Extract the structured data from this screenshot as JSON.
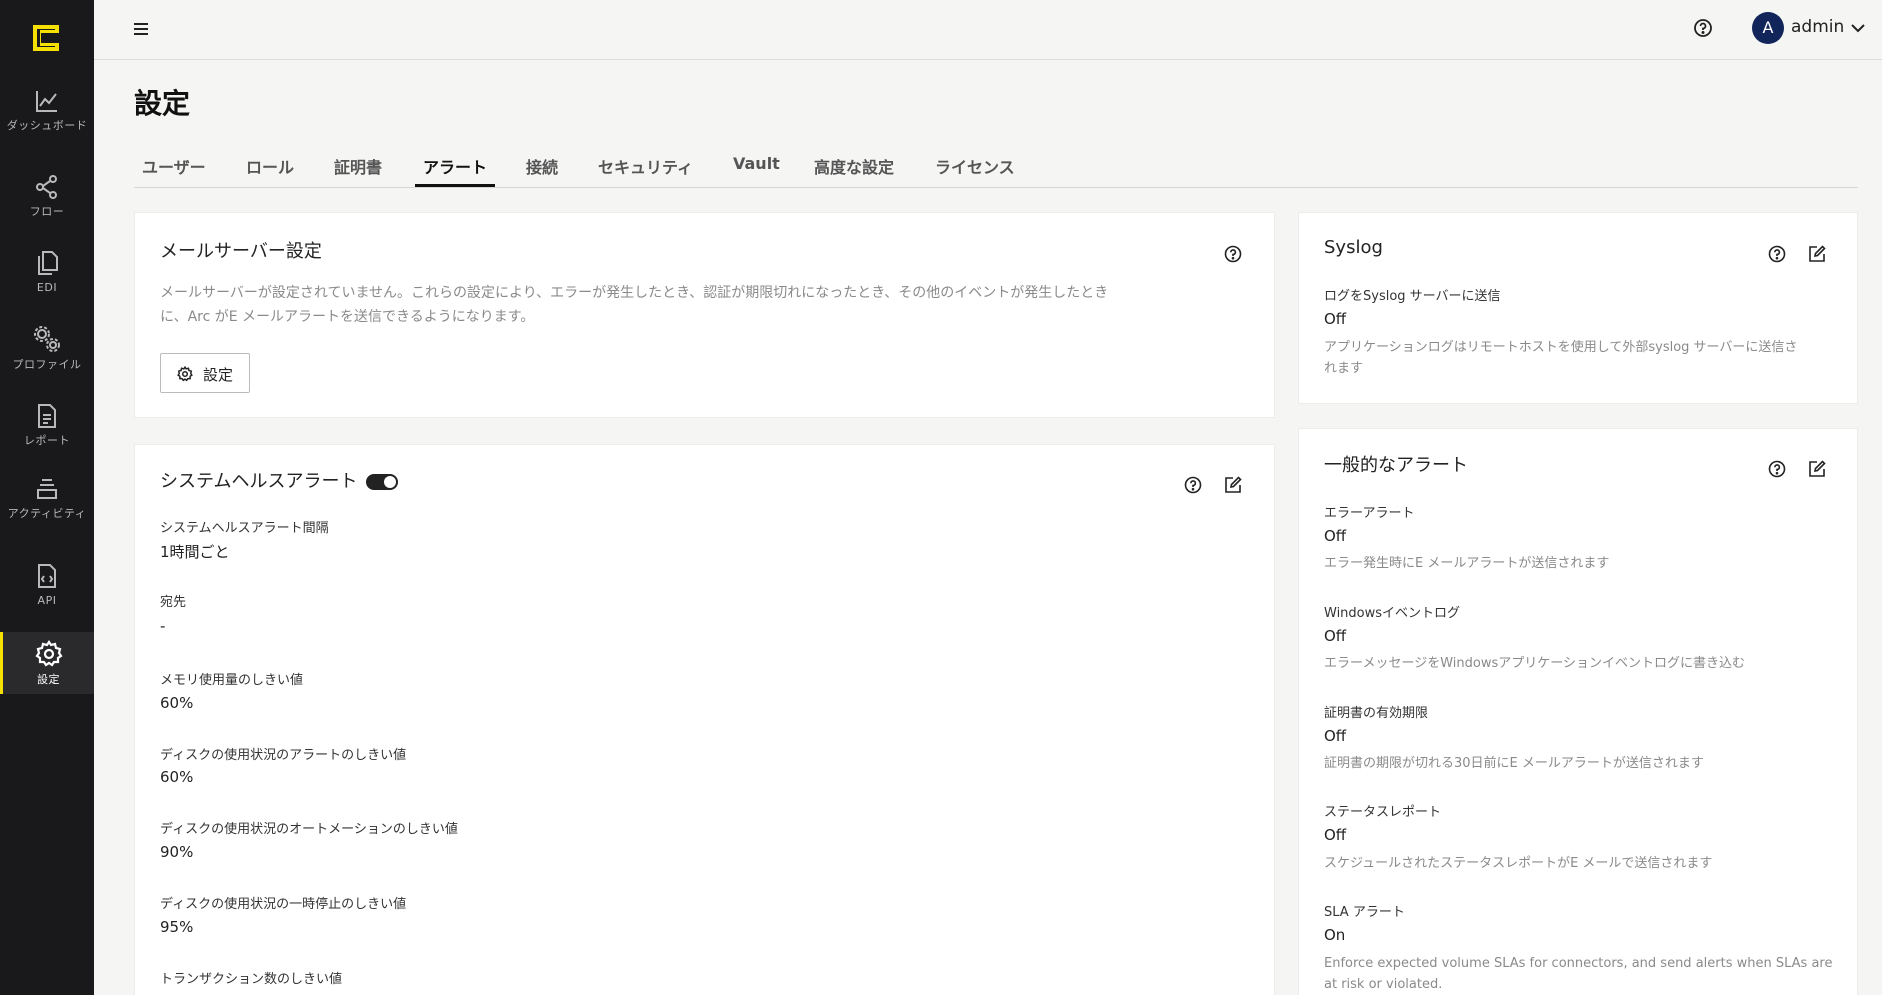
{
  "nav": {
    "items": [
      {
        "label": "ダッシュボード",
        "icon": "chart-line-icon"
      },
      {
        "label": "フロー",
        "icon": "share-nodes-icon"
      },
      {
        "label": "EDI",
        "icon": "documents-icon"
      },
      {
        "label": "プロファイル",
        "icon": "gears-icon"
      },
      {
        "label": "レポート",
        "icon": "report-icon"
      },
      {
        "label": "アクティビティ",
        "icon": "layers-icon"
      },
      {
        "label": "API",
        "icon": "api-file-icon"
      },
      {
        "label": "設定",
        "icon": "gear-icon"
      }
    ],
    "active_index": 7,
    "accent_color": "#f5e000"
  },
  "header": {
    "user_initial": "A",
    "username": "admin",
    "avatar_color": "#12255a"
  },
  "page": {
    "title": "設定",
    "tabs": [
      "ユーザー",
      "ロール",
      "証明書",
      "アラート",
      "接続",
      "セキュリティ",
      "Vault",
      "高度な設定",
      "ライセンス"
    ],
    "active_tab": "アラート"
  },
  "mail_server": {
    "title": "メールサーバー設定",
    "description_line1": "メールサーバーが設定されていません。これらの設定により、エラーが発生したとき、認証が期限切れになったとき、その他のイベントが発生したとき",
    "description_line2": "に、Arc がE メールアラートを送信できるようになります。",
    "button_label": "設定"
  },
  "system_health": {
    "title": "システムヘルスアラート",
    "enabled": true,
    "fields": [
      {
        "label": "システムヘルスアラート間隔",
        "value": "1時間ごと"
      },
      {
        "label": "宛先",
        "value": "-"
      },
      {
        "label": "メモリ使用量のしきい値",
        "value": "60%"
      },
      {
        "label": "ディスクの使用状況のアラートのしきい値",
        "value": "60%"
      },
      {
        "label": "ディスクの使用状況のオートメーションのしきい値",
        "value": "90%"
      },
      {
        "label": "ディスクの使用状況の一時停止のしきい値",
        "value": "95%"
      },
      {
        "label": "トランザクション数のしきい値",
        "value": ""
      }
    ]
  },
  "syslog": {
    "title": "Syslog",
    "label": "ログをSyslog サーバーに送信",
    "value": "Off",
    "hint_line1": "アプリケーションログはリモートホストを使用して外部syslog サーバーに送信さ",
    "hint_line2": "れます"
  },
  "general_alerts": {
    "title": "一般的なアラート",
    "items": [
      {
        "label": "エラーアラート",
        "value": "Off",
        "hint": "エラー発生時にE メールアラートが送信されます"
      },
      {
        "label": "Windowsイベントログ",
        "value": "Off",
        "hint": "エラーメッセージをWindowsアプリケーションイベントログに書き込む"
      },
      {
        "label": "証明書の有効期限",
        "value": "Off",
        "hint": "証明書の期限が切れる30日前にE メールアラートが送信されます"
      },
      {
        "label": "ステータスレポート",
        "value": "Off",
        "hint": "スケジュールされたステータスレポートがE メールで送信されます"
      },
      {
        "label": "SLA アラート",
        "value": "On",
        "hint_line1": "Enforce expected volume SLAs for connectors, and send alerts when SLAs are",
        "hint_line2": "at risk or violated."
      }
    ]
  }
}
